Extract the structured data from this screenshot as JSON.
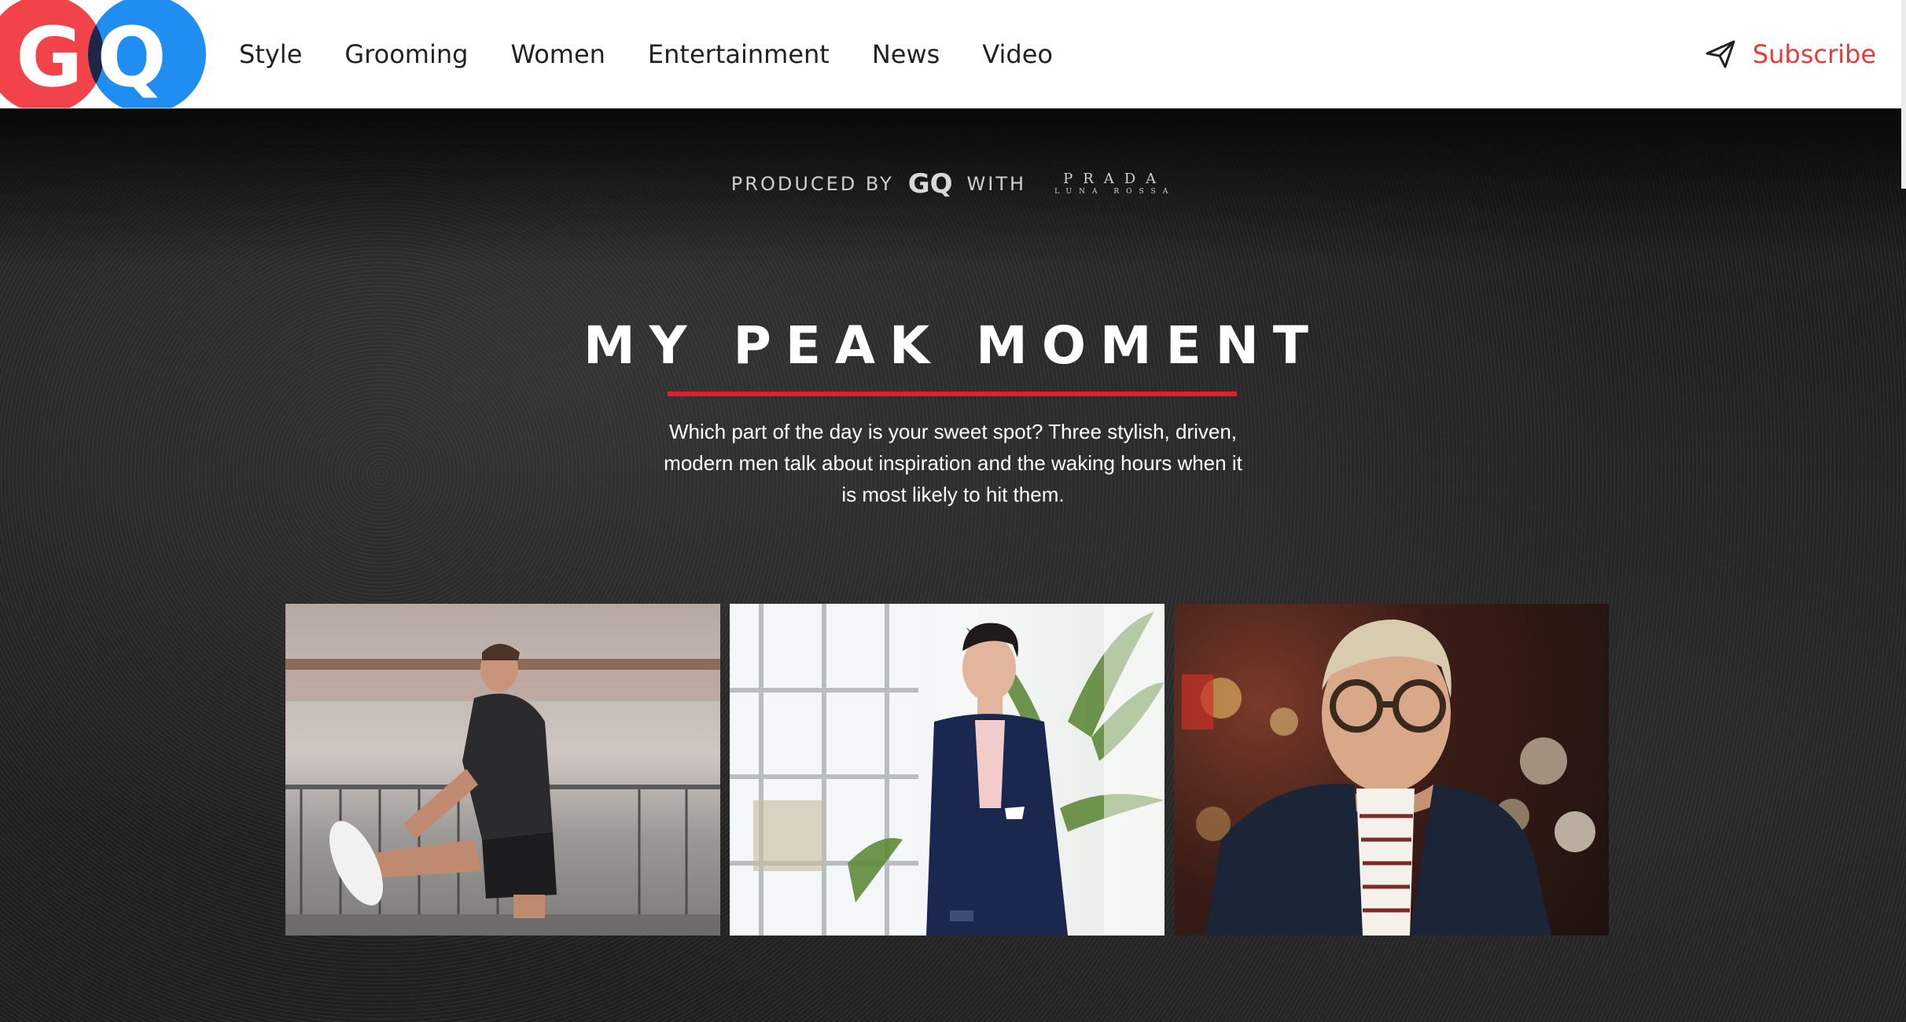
{
  "header": {
    "logo_text": "GQ",
    "nav": [
      {
        "label": "Style"
      },
      {
        "label": "Grooming"
      },
      {
        "label": "Women"
      },
      {
        "label": "Entertainment"
      },
      {
        "label": "News"
      },
      {
        "label": "Video"
      }
    ],
    "subscribe_label": "Subscribe",
    "subscribe_icon": "paper-plane-icon"
  },
  "hero": {
    "produced_by": "PRODUCED BY",
    "produced_logo": "GQ",
    "with": "WITH",
    "partner_top": "PRADA",
    "partner_bottom": "LUNA ROSSA",
    "title": "MY PEAK MOMENT",
    "intro": "Which part of the day is your sweet spot? Three stylish, driven, modern men talk about inspiration and the waking hours when it is most likely to hit them.",
    "accent_color": "#e0202a"
  },
  "colors": {
    "logo_red": "#f2424a",
    "logo_blue": "#1f8df2",
    "subscribe_red": "#e63c3c"
  }
}
